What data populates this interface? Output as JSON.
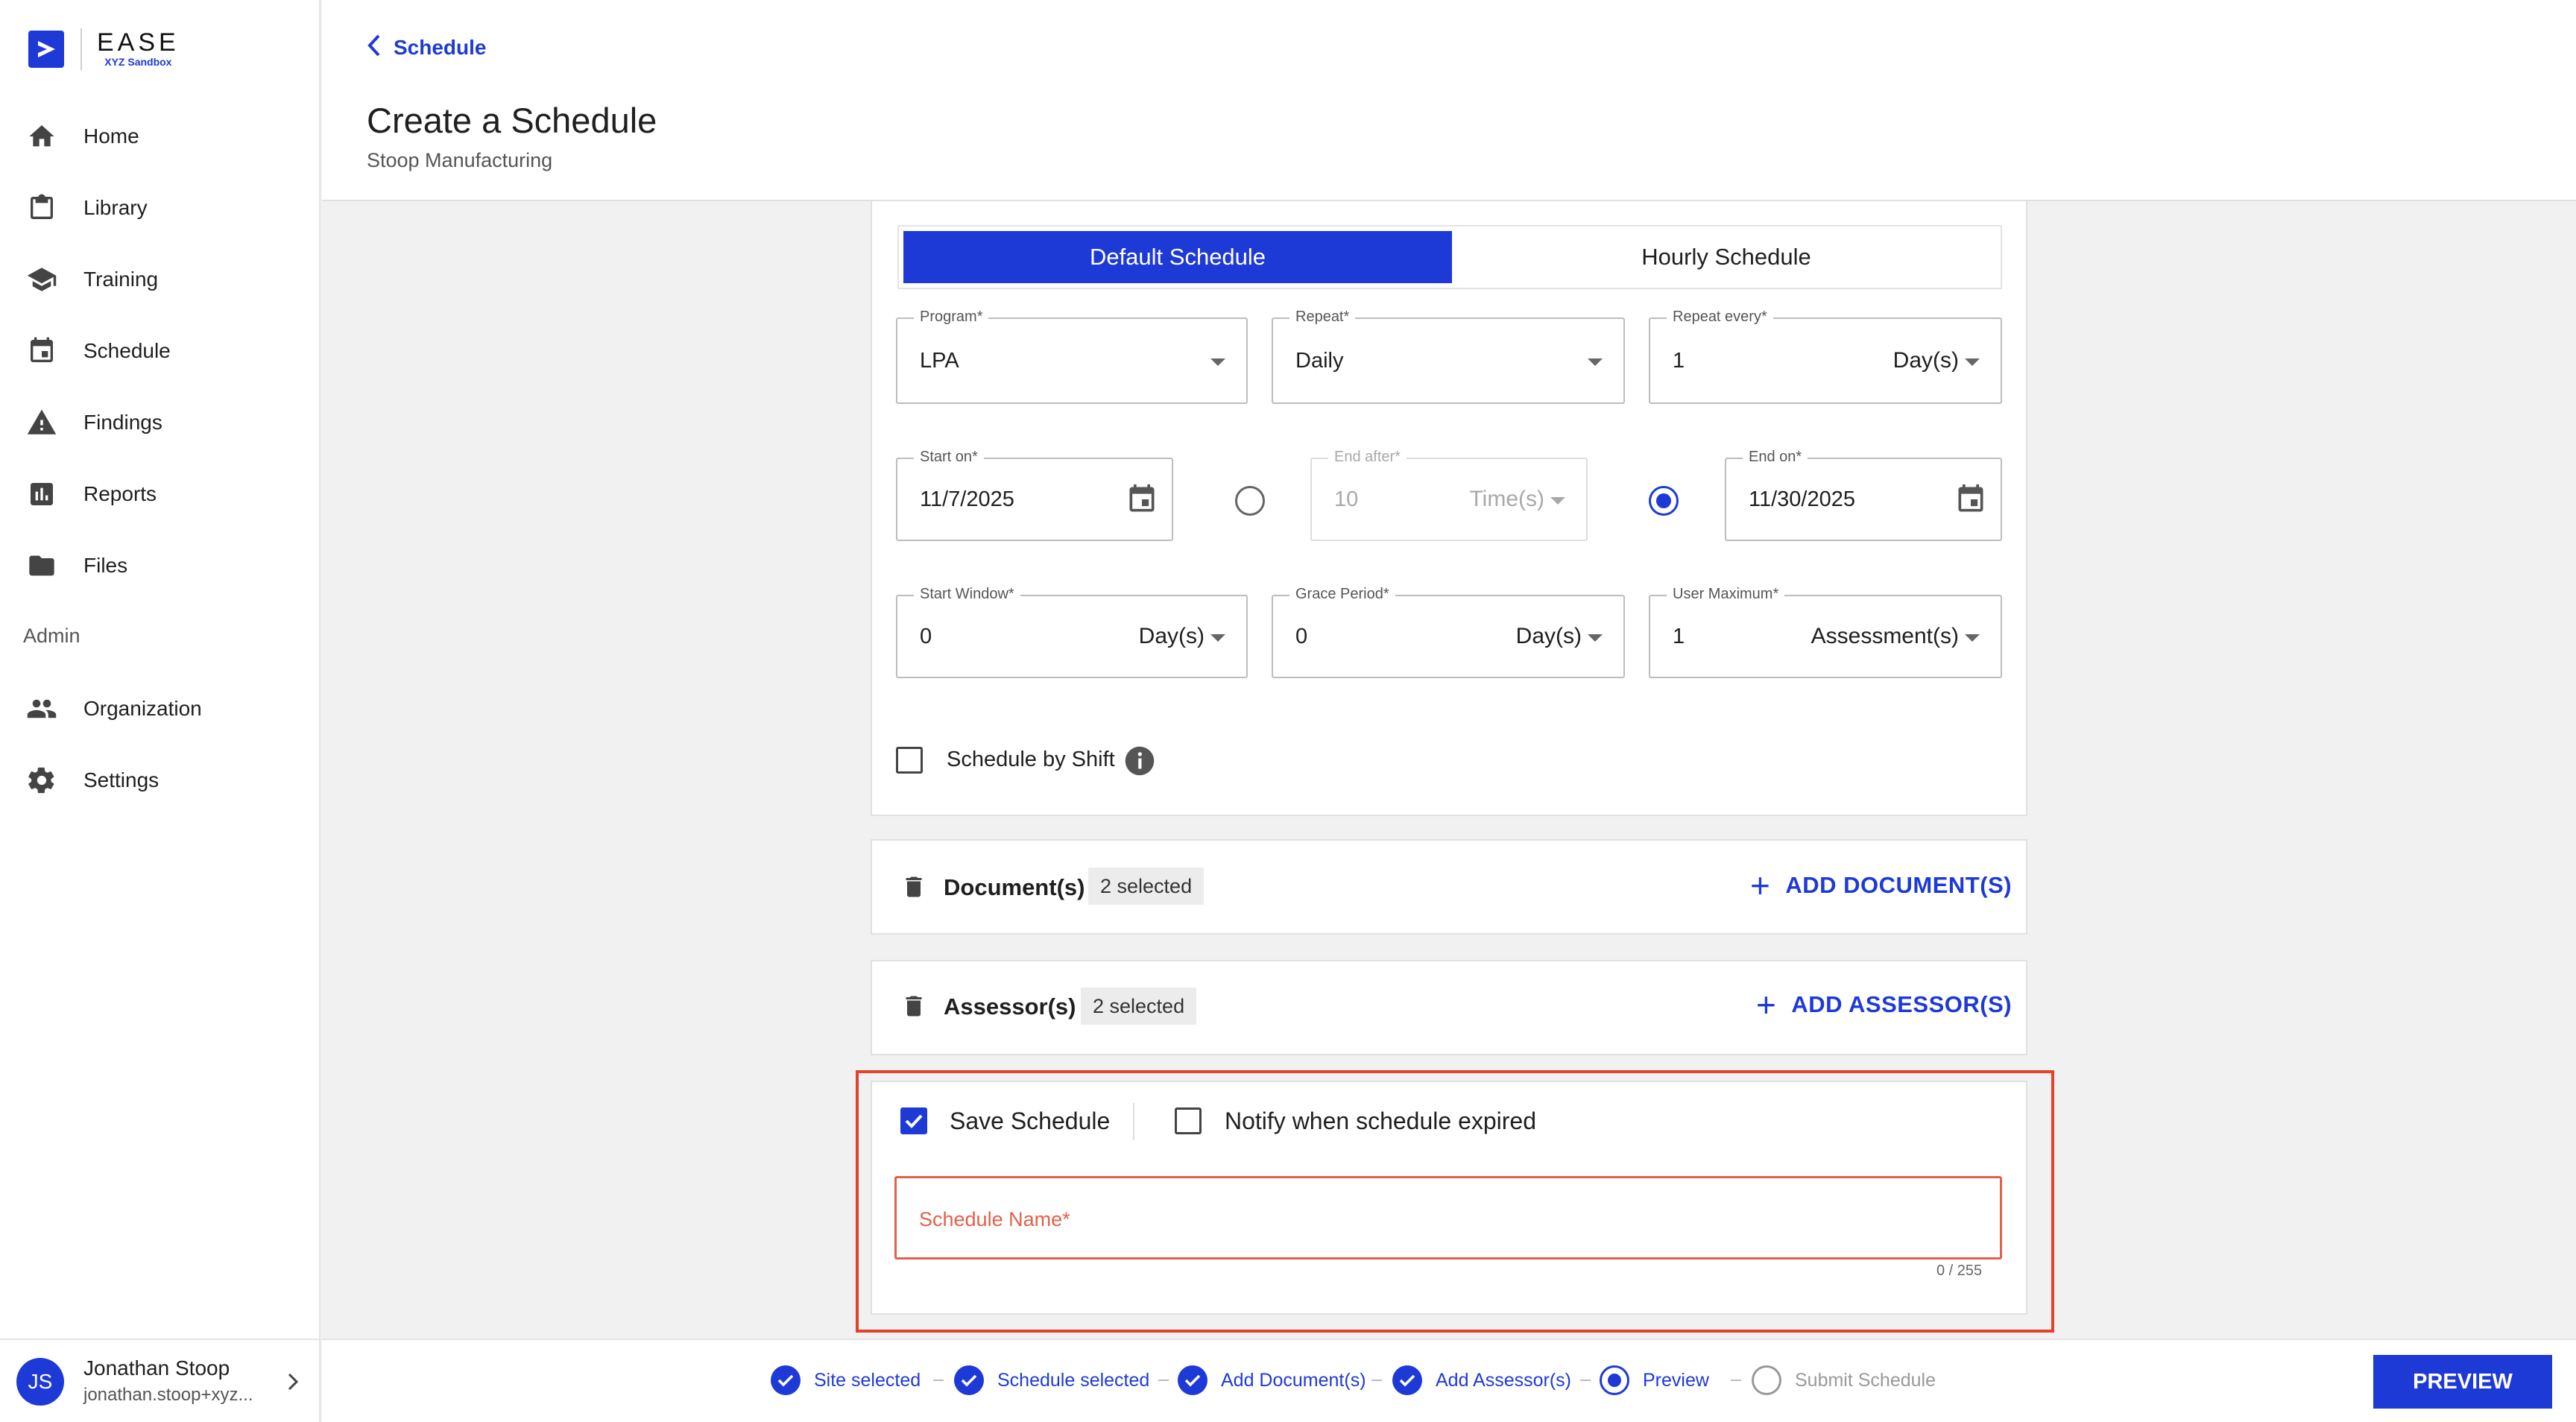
{
  "brand": {
    "name": "EASE",
    "subtitle": "XYZ Sandbox",
    "color": "#1e3ad6"
  },
  "sidebar": {
    "items": [
      {
        "label": "Home",
        "icon": "home-icon"
      },
      {
        "label": "Library",
        "icon": "clipboard-icon"
      },
      {
        "label": "Training",
        "icon": "graduation-cap-icon"
      },
      {
        "label": "Schedule",
        "icon": "calendar-icon"
      },
      {
        "label": "Findings",
        "icon": "warning-icon"
      },
      {
        "label": "Reports",
        "icon": "bar-chart-icon"
      },
      {
        "label": "Files",
        "icon": "folder-icon"
      }
    ],
    "admin_label": "Admin",
    "admin_items": [
      {
        "label": "Organization",
        "icon": "people-icon"
      },
      {
        "label": "Settings",
        "icon": "gear-icon"
      }
    ]
  },
  "user": {
    "initials": "JS",
    "name": "Jonathan Stoop",
    "email": "jonathan.stoop+xyz..."
  },
  "header": {
    "back_label": "Schedule",
    "title": "Create a Schedule",
    "subtitle": "Stoop Manufacturing"
  },
  "schedule_type": {
    "options": [
      "Default Schedule",
      "Hourly Schedule"
    ],
    "selected": "Default Schedule"
  },
  "form": {
    "program": {
      "label": "Program*",
      "value": "LPA"
    },
    "repeat": {
      "label": "Repeat*",
      "value": "Daily"
    },
    "repeat_every": {
      "label": "Repeat every*",
      "value": "1",
      "unit": "Day(s)"
    },
    "start_on": {
      "label": "Start on*",
      "value": "11/7/2025"
    },
    "end_after": {
      "label": "End after*",
      "value": "10",
      "unit": "Time(s)",
      "selected": false
    },
    "end_on": {
      "label": "End on*",
      "value": "11/30/2025",
      "selected": true
    },
    "start_window": {
      "label": "Start Window*",
      "value": "0",
      "unit": "Day(s)"
    },
    "grace_period": {
      "label": "Grace Period*",
      "value": "0",
      "unit": "Day(s)"
    },
    "user_maximum": {
      "label": "User Maximum*",
      "value": "1",
      "unit": "Assessment(s)"
    },
    "schedule_by_shift": {
      "label": "Schedule by Shift",
      "checked": false
    }
  },
  "documents": {
    "title": "Document(s)",
    "badge": "2 selected",
    "add_label": "ADD DOCUMENT(S)"
  },
  "assessors": {
    "title": "Assessor(s)",
    "badge": "2 selected",
    "add_label": "ADD ASSESSOR(S)"
  },
  "save": {
    "save_label": "Save Schedule",
    "save_checked": true,
    "notify_label": "Notify when schedule expired",
    "notify_checked": false,
    "name_placeholder": "Schedule Name*",
    "counter": "0 / 255",
    "error_color": "#e2412a"
  },
  "steps": [
    {
      "label": "Site selected",
      "state": "done"
    },
    {
      "label": "Schedule selected",
      "state": "done"
    },
    {
      "label": "Add Document(s)",
      "state": "done"
    },
    {
      "label": "Add Assessor(s)",
      "state": "done"
    },
    {
      "label": "Preview",
      "state": "current"
    },
    {
      "label": "Submit Schedule",
      "state": "pending"
    }
  ],
  "preview_button": "PREVIEW"
}
